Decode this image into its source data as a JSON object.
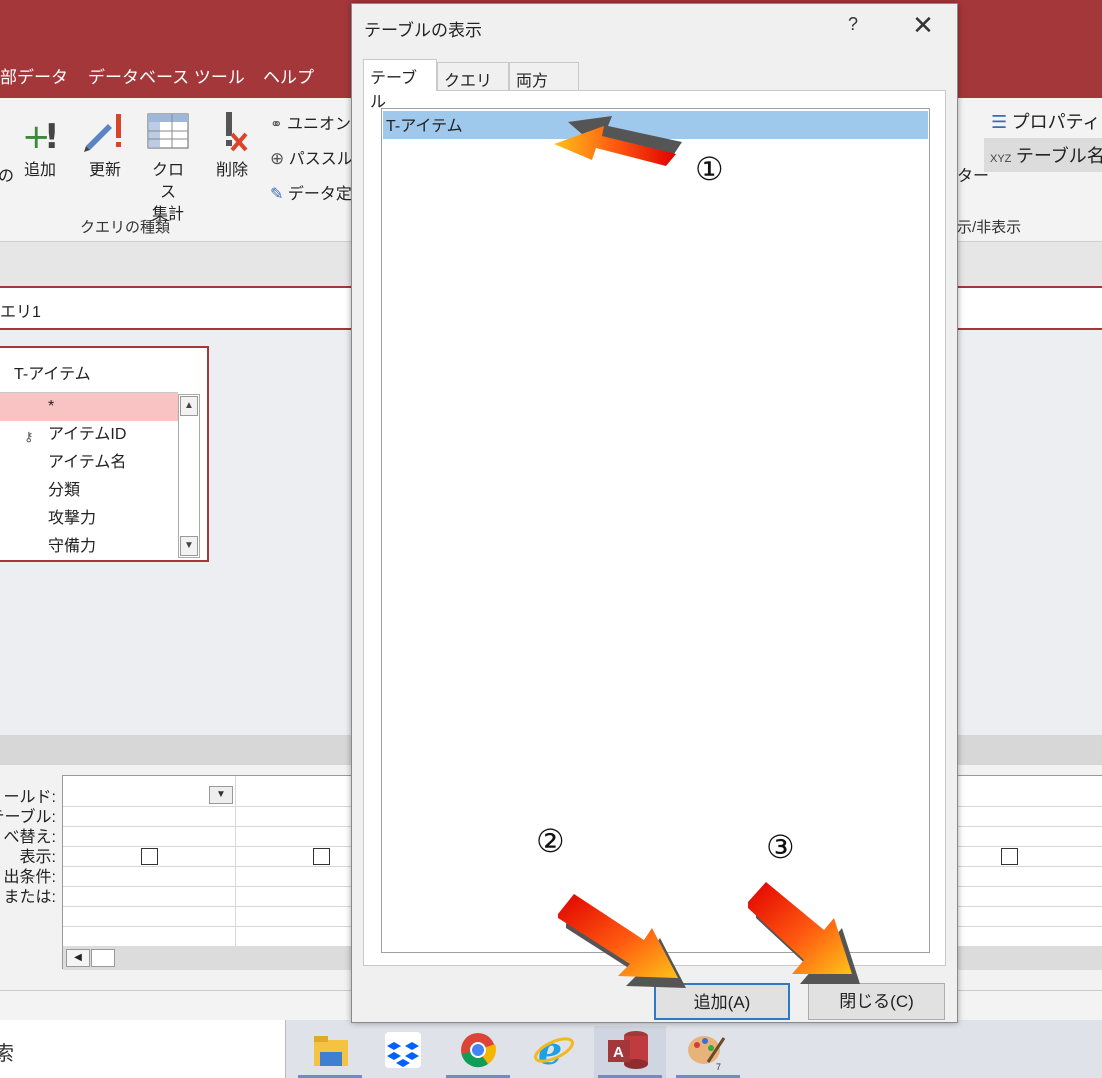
{
  "ribbon_tabs": [
    "部データ",
    "データベース ツール",
    "ヘルプ"
  ],
  "ribbon": {
    "left_fragment": "の",
    "append_label": "追加",
    "update_label": "更新",
    "crosstab_label_line1": "クロス",
    "crosstab_label_line2": "集計",
    "delete_label": "削除",
    "union_label": "ユニオン",
    "passthrough_label": "パススル",
    "datadef_label": "データ定",
    "query_type_group": "クエリの種類",
    "property_label": "プロパティシ",
    "table_names_label": "テーブル名",
    "filter_fragment": "ター",
    "show_hide_group": "示/非表示"
  },
  "document_tab": "エリ1",
  "table_box": {
    "title": "T-アイテム",
    "fields": [
      "*",
      "アイテムID",
      "アイテム名",
      "分類",
      "攻撃力",
      "守備力"
    ]
  },
  "grid_labels": [
    "ィールド:",
    "テーブル:",
    "べ替え:",
    "表示:",
    "出条件:",
    "または:"
  ],
  "taskbar": {
    "search_fragment": "索",
    "apps": [
      "file-explorer-icon",
      "dropbox-icon",
      "chrome-icon",
      "internet-explorer-icon",
      "access-icon",
      "paint-icon"
    ]
  },
  "dialog": {
    "title": "テーブルの表示",
    "help": "?",
    "close": "✕",
    "tabs": [
      "テーブル",
      "クエリ",
      "両方"
    ],
    "list_items": [
      "T-アイテム"
    ],
    "add_button": "追加(A)",
    "close_button": "閉じる(C)"
  },
  "annotations": [
    "①",
    "②",
    "③"
  ],
  "colors": {
    "accent": "#a4373a",
    "selection": "#9fc9ec",
    "field_selection": "#f9c3c3"
  }
}
